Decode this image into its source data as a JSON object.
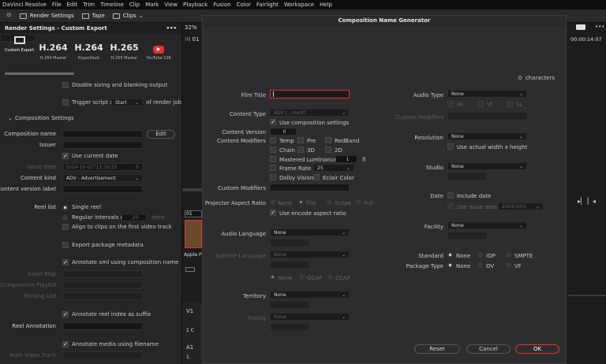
{
  "menubar": [
    "DaVinci Resolve",
    "File",
    "Edit",
    "Trim",
    "Timeline",
    "Clip",
    "Mark",
    "View",
    "Playback",
    "Fusion",
    "Color",
    "Fairlight",
    "Workspace",
    "Help"
  ],
  "toolbar": {
    "render_settings": "Render Settings",
    "tape": "Tape",
    "clips": "Clips"
  },
  "left": {
    "title": "Render Settings - Custom Export",
    "more": "•••",
    "presets": [
      {
        "big": "",
        "label": "Custom Export"
      },
      {
        "big": "H.264",
        "label": "H.264 Master"
      },
      {
        "big": "H.264",
        "label": "HyperDeck"
      },
      {
        "big": "H.265",
        "label": "H.265 Master"
      },
      {
        "big": "",
        "label": "YouTube 108"
      }
    ],
    "disable_sizing": "Disable sizing and blanking output",
    "trigger_script": "Trigger script at",
    "trigger_value": "Start",
    "trigger_suffix": "of render job",
    "comp_settings": "Composition Settings",
    "comp_name_label": "Composition name",
    "edit_btn": "Edit",
    "issuer_label": "Issuer",
    "use_current_date": "Use current date",
    "issue_date_label": "Issue date",
    "issue_date_value": "2024-10-02T11:16:55",
    "issue_date_num": "0",
    "content_kind_label": "Content kind",
    "content_kind_value": "ADV - Advertisement",
    "content_version_label": "Content version label",
    "reel_list_label": "Reel list",
    "single_reel": "Single reel",
    "regular_intervals": "Regular intervals of",
    "interval_value": "20",
    "interval_unit": "mins",
    "align_clips": "Align to clips on the first video track",
    "export_package": "Export package metadata",
    "annotate_xml": "Annotate xml using composition name",
    "asset_map": "Asset Map",
    "comp_playlist": "Composition Playlist",
    "packing_list": "Packing List",
    "annotate_reel": "Annotate reel index as suffix",
    "reel_annotation": "Reel Annotation",
    "annotate_media": "Annotate media using filename",
    "main_video_track": "Main Video Track"
  },
  "middle": {
    "zoom": "32%",
    "in": "IN",
    "in_val": "01",
    "tab": "01",
    "label": "Apple P",
    "v1": "V1",
    "a1": "A1",
    "num1": "1 C",
    "num2": "1."
  },
  "right": {
    "timecode": "00:00:14:07",
    "more": "•••"
  },
  "modal": {
    "title": "Composition Name Generator",
    "char_count": "0",
    "char_label": "characters",
    "film_title": "Film Title",
    "content_type": "Content Type",
    "content_type_value": "ADV (...ment)",
    "use_comp_settings": "Use composition settings",
    "content_version": "Content Version",
    "content_version_value": "0",
    "content_modifiers": "Content Modifiers",
    "mod_temp": "Temp",
    "mod_pre": "Pre",
    "mod_redband": "RedBand",
    "mod_chain": "Chain",
    "mod_3d": "3D",
    "mod_2d": "2D",
    "mastered_luminance": "Mastered Luminance",
    "lum_value": "1",
    "lum_unit": "fl",
    "frame_rate": "Frame Rate",
    "fr_value": "25",
    "dolby_vision": "Dolby Vision",
    "eclair_color": "Eclair Color",
    "custom_modifiers": "Custom Modifiers",
    "projector_aspect": "Projector Aspect Ratio",
    "ar_none": "None",
    "ar_flat": "Flat",
    "ar_scope": "Scope",
    "ar_full": "Full",
    "use_encode_aspect": "Use encode aspect ratio",
    "audio_language": "Audio Language",
    "audio_language_value": "None",
    "subtitle_language": "Subtitle Language",
    "subtitle_language_value": "None",
    "sub_none": "None",
    "sub_ocap": "OCAP",
    "sub_ccap": "CCAP",
    "territory": "Territory",
    "territory_value": "None",
    "rating": "Rating",
    "rating_value": "None",
    "audio_type": "Audio Type",
    "audio_type_value": "None",
    "at_hi": "HI",
    "at_vi": "VI",
    "at_sl": "SL",
    "custom_modifiers_r": "Custom Modifiers",
    "resolution": "Resolution",
    "resolution_value": "None",
    "use_actual": "Use actual width x height",
    "studio": "Studio",
    "studio_value": "None",
    "date": "Date",
    "include_date": "Include date",
    "use_issue_date": "Use issue date",
    "date_value": "2024/10/1",
    "facility": "Facility",
    "facility_value": "None",
    "standard": "Standard",
    "std_none": "None",
    "std_iop": "IOP",
    "std_smpte": "SMPTE",
    "package_type": "Package Type",
    "pt_none": "None",
    "pt_ov": "OV",
    "pt_vf": "VF",
    "reset": "Reset",
    "cancel": "Cancel",
    "ok": "OK"
  },
  "colors": {
    "accent": "#e0332f",
    "bg": "#2d2d30"
  }
}
